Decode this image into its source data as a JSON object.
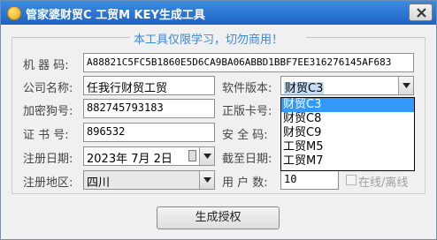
{
  "window": {
    "title": "管家婆财贸C 工贸M KEY生成工具"
  },
  "notice": "本工具仅限学习，切勿商用！",
  "form": {
    "machine_code": {
      "label": "机 器 码:",
      "value": "A88821C5FC5B1860E5D6CA9BA06ABBD1BBF7EE316276145AF683"
    },
    "company": {
      "label": "公司名称:",
      "value": "任我行财贸工贸"
    },
    "version": {
      "label": "软件版本:",
      "value": "财贸C3",
      "options": [
        "财贸C3",
        "财贸C8",
        "财贸C9",
        "工贸M5",
        "工贸M7"
      ]
    },
    "dog_no": {
      "label": "加密狗号:",
      "value": "882745793183"
    },
    "card_no": {
      "label": "正版卡号:"
    },
    "cert_no": {
      "label": "证 书 号:",
      "value": "896532"
    },
    "security_code": {
      "label": "安 全 码:"
    },
    "reg_date": {
      "label": "注册日期:",
      "value": "2023年 7月 2日"
    },
    "end_date": {
      "label": "截至日期:"
    },
    "region": {
      "label": "注册地区:",
      "value": "四川"
    },
    "users": {
      "label": "用 户 数:",
      "value": "10"
    },
    "online_offline": {
      "label": "在线/离线",
      "checked": false
    }
  },
  "generate_button": "生成授权"
}
